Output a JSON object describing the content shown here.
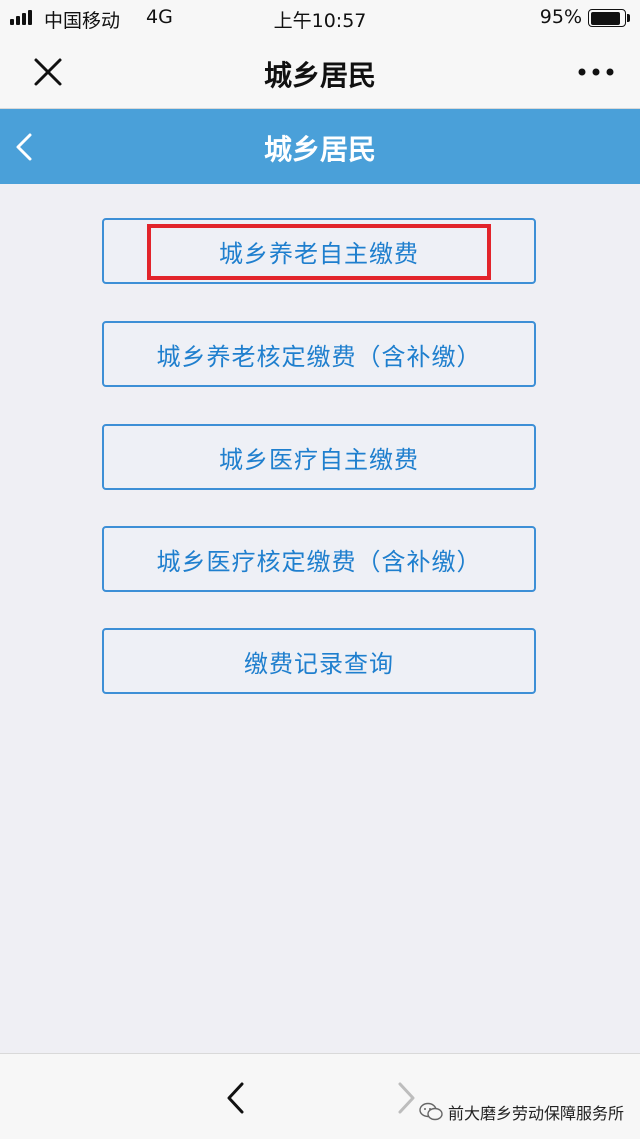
{
  "status_bar": {
    "carrier": "中国移动",
    "network": "4G",
    "time": "上午10:57",
    "battery_percent": "95%",
    "battery_level": 0.95
  },
  "title_bar": {
    "title": "城乡居民",
    "close_icon": "close-icon",
    "more_icon": "more-dots-icon"
  },
  "header": {
    "title": "城乡居民",
    "back_icon": "chevron-left-icon"
  },
  "menu": [
    {
      "label": "城乡养老自主缴费",
      "highlighted": true
    },
    {
      "label": "城乡养老核定缴费（含补缴）"
    },
    {
      "label": "城乡医疗自主缴费"
    },
    {
      "label": "城乡医疗核定缴费（含补缴）"
    },
    {
      "label": "缴费记录查询"
    }
  ],
  "colors": {
    "header_bg": "#4aa0d9",
    "button_border": "#3d8fd6",
    "button_text": "#1f7fce",
    "highlight": "#e2242b"
  },
  "toolbar": {
    "back_icon": "chevron-left-icon",
    "forward_icon": "chevron-right-icon"
  },
  "watermark": {
    "text": "前大磨乡劳动保障服务所",
    "icon": "wechat-icon"
  }
}
